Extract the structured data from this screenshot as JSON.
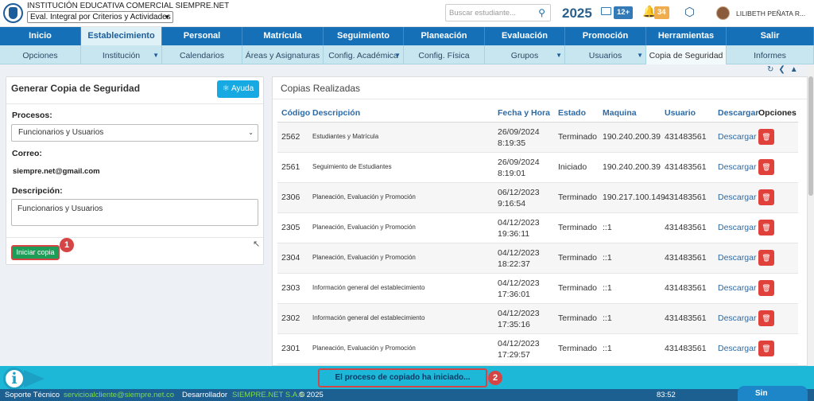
{
  "header": {
    "school_name": "INSTITUCIÓN EDUCATIVA COMERCIAL SIEMPRE.NET",
    "eval_select": "Eval. Integral por Criterios y Actividades",
    "search_placeholder": "Buscar estudiante...",
    "year": "2025",
    "mail_badge": "12+",
    "notif_badge": "34",
    "user_name": "LILIBETH PEÑATA R..."
  },
  "nav_main": [
    "Inicio",
    "Establecimiento",
    "Personal",
    "Matrícula",
    "Seguimiento",
    "Planeación",
    "Evaluación",
    "Promoción",
    "Herramientas",
    "Salir"
  ],
  "nav_main_active": "Establecimiento",
  "nav_sub": [
    "Opciones",
    "Institución",
    "Calendarios",
    "Áreas y Asignaturas",
    "Config. Académica",
    "Config. Física",
    "Grupos",
    "Usuarios",
    "Copia de Seguridad",
    "Informes"
  ],
  "nav_sub_active": "Copia de Seguridad",
  "left_panel": {
    "title": "Generar Copia de Seguridad",
    "help_button": "Ayuda",
    "procesos_label": "Procesos:",
    "procesos_value": "Funcionarios y Usuarios",
    "correo_label": "Correo:",
    "correo_value": "siempre.net@gmail.com",
    "descripcion_label": "Descripción:",
    "descripcion_value": "Funcionarios y Usuarios",
    "start_button": "Iniciar copia",
    "callout": "1"
  },
  "right_panel": {
    "title": "Copias Realizadas",
    "columns": [
      "Código",
      "Descripción",
      "Fecha y Hora",
      "Estado",
      "Maquina",
      "Usuario",
      "Descargar",
      "Opciones"
    ],
    "rows": [
      {
        "code": "2562",
        "desc": "Estudiantes y Matrícula",
        "date": "26/09/2024",
        "time": "8:19:35",
        "state": "Terminado",
        "machine": "190.240.200.39",
        "user": "431483561",
        "download": "Descargar"
      },
      {
        "code": "2561",
        "desc": "Seguimiento de Estudiantes",
        "date": "26/09/2024",
        "time": "8:19:01",
        "state": "Iniciado",
        "machine": "190.240.200.39",
        "user": "431483561",
        "download": "Descargar"
      },
      {
        "code": "2306",
        "desc": "Planeación, Evaluación y Promoción",
        "date": "06/12/2023",
        "time": "9:16:54",
        "state": "Terminado",
        "machine": "190.217.100.149",
        "user": "431483561",
        "download": "Descargar"
      },
      {
        "code": "2305",
        "desc": "Planeación, Evaluación y Promoción",
        "date": "04/12/2023",
        "time": "19:36:11",
        "state": "Terminado",
        "machine": "::1",
        "user": "431483561",
        "download": "Descargar"
      },
      {
        "code": "2304",
        "desc": "Planeación, Evaluación y Promoción",
        "date": "04/12/2023",
        "time": "18:22:37",
        "state": "Terminado",
        "machine": "::1",
        "user": "431483561",
        "download": "Descargar"
      },
      {
        "code": "2303",
        "desc": "Información general del establecimiento",
        "date": "04/12/2023",
        "time": "17:36:01",
        "state": "Terminado",
        "machine": "::1",
        "user": "431483561",
        "download": "Descargar"
      },
      {
        "code": "2302",
        "desc": "Información general del establecimiento",
        "date": "04/12/2023",
        "time": "17:35:16",
        "state": "Terminado",
        "machine": "::1",
        "user": "431483561",
        "download": "Descargar"
      },
      {
        "code": "2301",
        "desc": "Planeación, Evaluación y Promoción",
        "date": "04/12/2023",
        "time": "17:29:57",
        "state": "Terminado",
        "machine": "::1",
        "user": "431483561",
        "download": "Descargar"
      }
    ]
  },
  "status_bar": {
    "message": "El proceso de copiado ha iniciado...",
    "callout": "2"
  },
  "footer": {
    "support_label": "Soporte Técnico",
    "support_email": "servicioalcliente@siempre.net.co",
    "dev_label": "Desarrollador",
    "dev_name": "SIEMPRE.NET S.A.S",
    "copyright": "© 2025",
    "clock": "83:52",
    "chat_label": "Sin"
  },
  "colors": {
    "primary": "#1570b8",
    "accent": "#17a9e1",
    "success": "#1e9d58",
    "danger": "#e0413a",
    "highlight": "#d64545"
  }
}
